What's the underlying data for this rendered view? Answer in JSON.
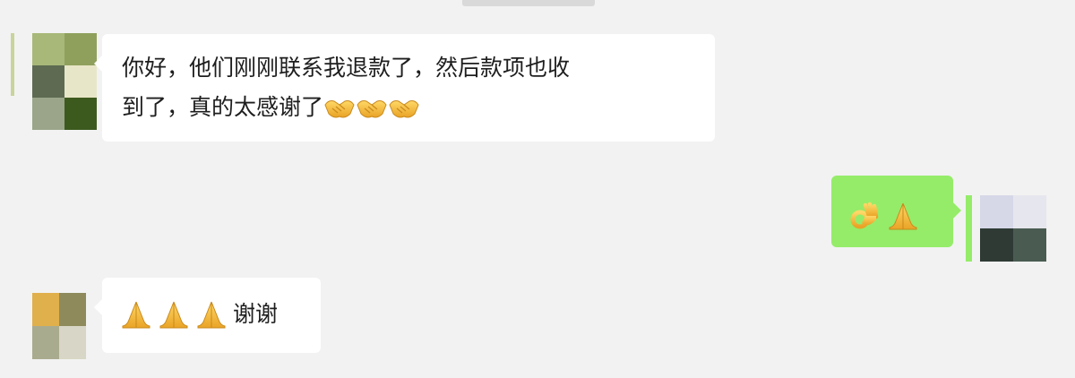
{
  "conversation": {
    "messages": [
      {
        "sender": "other",
        "line1": "你好，他们刚刚联系我退款了，然后款项也收",
        "line2": "到了，真的太感谢了",
        "trailing_emojis": [
          "handshake-icon",
          "handshake-icon",
          "handshake-icon"
        ]
      },
      {
        "sender": "self",
        "emojis": [
          "ok-hand-icon",
          "folded-hands-icon"
        ]
      },
      {
        "sender": "other",
        "leading_emojis": [
          "folded-hands-icon",
          "folded-hands-icon",
          "folded-hands-icon"
        ],
        "text": "谢谢"
      }
    ]
  },
  "colors": {
    "background": "#f2f2f2",
    "incoming_bubble": "#ffffff",
    "outgoing_bubble": "#95ec69",
    "emoji_gold": "#f4b73b"
  }
}
